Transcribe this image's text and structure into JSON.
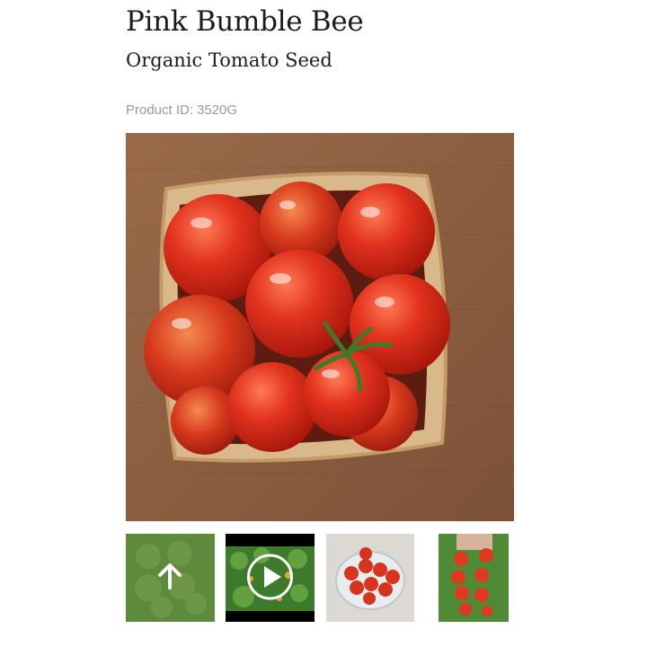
{
  "product": {
    "title": "Pink Bumble Bee",
    "subtitle": "Organic Tomato Seed",
    "id_label": "Product ID:",
    "id_value": "3520G"
  },
  "main_image": {
    "alt": "Pink Bumble Bee cherry tomatoes in a wooden basket"
  },
  "thumbnails": [
    {
      "alt": "Scroll up",
      "icon": "arrow-up-icon"
    },
    {
      "alt": "Play video",
      "icon": "play-icon"
    },
    {
      "alt": "Tomatoes in a glass bowl"
    },
    {
      "alt": "Tomato cluster on the vine"
    }
  ]
}
